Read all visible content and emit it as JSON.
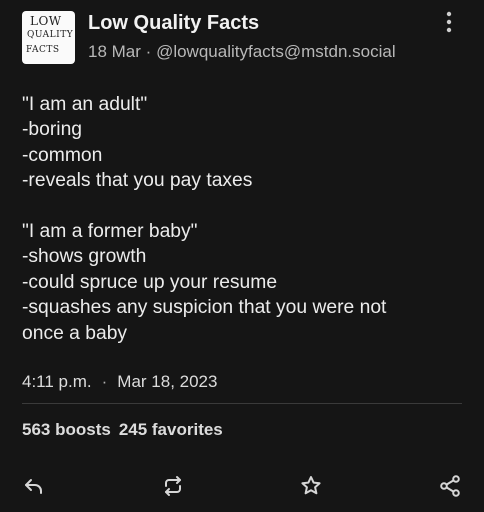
{
  "post": {
    "avatar": {
      "line1": "LOW",
      "line2": "QUALITY",
      "line3": "FACTS"
    },
    "author_name": "Low Quality Facts",
    "date_short": "18 Mar",
    "separator": "·",
    "handle": "@lowqualityfacts@mstdn.social",
    "body": {
      "lines_a": [
        "\"I am an adult\"",
        "-boring",
        "-common",
        "-reveals that you pay taxes"
      ],
      "lines_b": [
        "\"I am a former baby\"",
        "-shows growth",
        "-could spruce up your resume",
        "-squashes any suspicion that you were not",
        "once a baby"
      ]
    },
    "time": "4:11 p.m.",
    "date_long": "Mar 18, 2023",
    "boosts": "563 boosts",
    "favorites": "245 favorites"
  },
  "actions": {
    "icons": [
      "reply-icon",
      "boost-icon",
      "favorite-icon",
      "share-icon"
    ]
  },
  "colors": {
    "background": "#151515",
    "text": "#ececec",
    "muted": "#b8b8b8"
  }
}
